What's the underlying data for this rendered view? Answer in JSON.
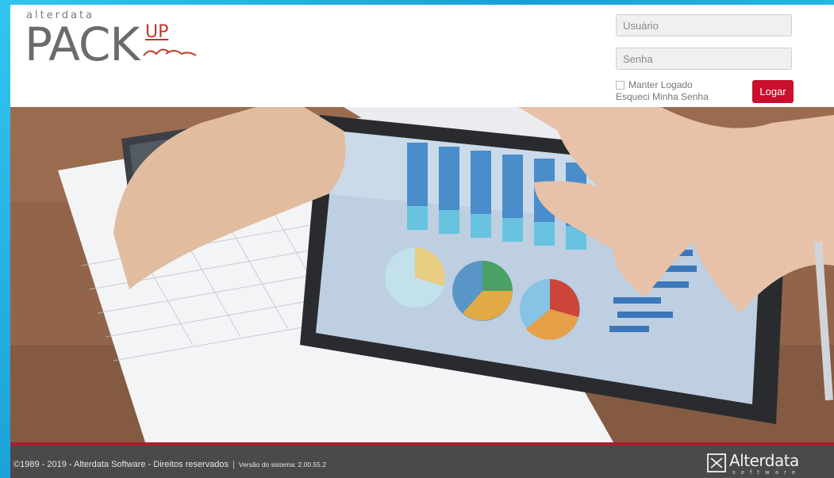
{
  "header": {
    "logo": {
      "brand": "alterdata",
      "name": "PACK",
      "suffix": "UP"
    },
    "login": {
      "username_placeholder": "Usuário",
      "password_placeholder": "Senha",
      "remember_label": "Manter Logado",
      "forgot_label": "Esqueci Minha Senha",
      "submit_label": "Logar"
    }
  },
  "hero": {
    "image": "tablet-with-charts-photo"
  },
  "footer": {
    "copyright": "©1989 - 2019 - Alterdata Software - Direitos reservados",
    "separator": "|",
    "version": "Versão do sistema: 2.00.55.2",
    "logo": {
      "name": "Alterdata",
      "sub": "software"
    }
  },
  "colors": {
    "frame": "#1ea9dc",
    "accent": "#c8102e",
    "footer_bg": "#4a4a4a",
    "footer_line": "#b01b2e"
  }
}
